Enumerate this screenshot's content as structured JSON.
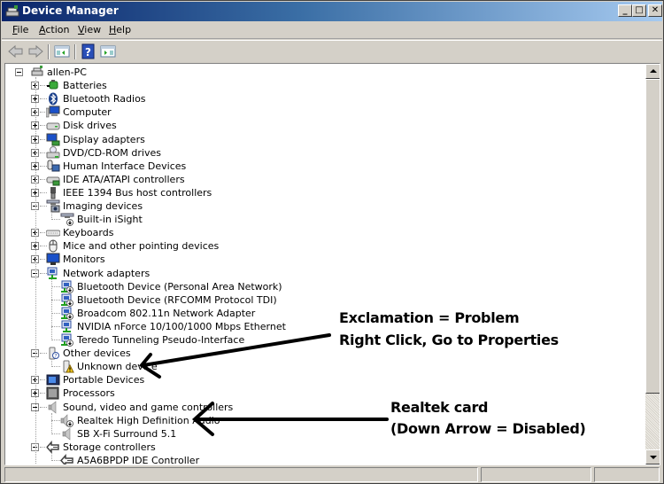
{
  "window": {
    "title": "Device Manager",
    "controls": {
      "minimize": "_",
      "maximize": "□",
      "close": "✕"
    }
  },
  "menu": [
    {
      "label": "File",
      "accel": "F"
    },
    {
      "label": "Action",
      "accel": "A"
    },
    {
      "label": "View",
      "accel": "V"
    },
    {
      "label": "Help",
      "accel": "H"
    }
  ],
  "toolbar": [
    {
      "name": "back-button",
      "icon": "arrow-left-icon",
      "enabled": false
    },
    {
      "name": "forward-button",
      "icon": "arrow-right-icon",
      "enabled": false
    },
    {
      "name": "show-hide-console-tree-button",
      "icon": "console-tree-icon"
    },
    {
      "name": "help-button",
      "icon": "help-icon",
      "glyph": "?"
    },
    {
      "name": "show-hide-action-pane-button",
      "icon": "action-pane-icon"
    }
  ],
  "tree": {
    "root": {
      "label": "allen-PC",
      "icon": "computer-network-icon",
      "expanded": true
    },
    "categories": [
      {
        "label": "Batteries",
        "icon": "battery-icon",
        "expanded": false,
        "children": []
      },
      {
        "label": "Bluetooth Radios",
        "icon": "bluetooth-icon",
        "expanded": false,
        "children": []
      },
      {
        "label": "Computer",
        "icon": "computer-icon",
        "expanded": false,
        "children": []
      },
      {
        "label": "Disk drives",
        "icon": "disk-drive-icon",
        "expanded": false,
        "children": []
      },
      {
        "label": "Display adapters",
        "icon": "display-adapter-icon",
        "expanded": false,
        "children": []
      },
      {
        "label": "DVD/CD-ROM drives",
        "icon": "dvd-drive-icon",
        "expanded": false,
        "children": []
      },
      {
        "label": "Human Interface Devices",
        "icon": "hid-icon",
        "expanded": false,
        "children": []
      },
      {
        "label": "IDE ATA/ATAPI controllers",
        "icon": "ide-controller-icon",
        "expanded": false,
        "children": []
      },
      {
        "label": "IEEE 1394 Bus host controllers",
        "icon": "firewire-icon",
        "expanded": false,
        "children": []
      },
      {
        "label": "Imaging devices",
        "icon": "camera-icon",
        "expanded": true,
        "children": [
          {
            "label": "Built-in iSight",
            "icon": "camera-disabled-icon",
            "status": "disabled"
          }
        ]
      },
      {
        "label": "Keyboards",
        "icon": "keyboard-icon",
        "expanded": false,
        "children": []
      },
      {
        "label": "Mice and other pointing devices",
        "icon": "mouse-icon",
        "expanded": false,
        "children": []
      },
      {
        "label": "Monitors",
        "icon": "monitor-icon",
        "expanded": false,
        "children": []
      },
      {
        "label": "Network adapters",
        "icon": "network-adapter-icon",
        "expanded": true,
        "children": [
          {
            "label": "Bluetooth Device (Personal Area Network)",
            "icon": "network-adapter-disabled-icon",
            "status": "disabled"
          },
          {
            "label": "Bluetooth Device (RFCOMM Protocol TDI)",
            "icon": "network-adapter-disabled-icon",
            "status": "disabled"
          },
          {
            "label": "Broadcom 802.11n Network Adapter",
            "icon": "network-adapter-disabled-icon",
            "status": "disabled"
          },
          {
            "label": "NVIDIA nForce 10/100/1000 Mbps Ethernet",
            "icon": "network-adapter-icon",
            "status": "ok"
          },
          {
            "label": "Teredo Tunneling Pseudo-Interface",
            "icon": "network-adapter-disabled-icon",
            "status": "disabled"
          }
        ]
      },
      {
        "label": "Other devices",
        "icon": "unknown-device-icon",
        "expanded": true,
        "children": [
          {
            "label": "Unknown device",
            "icon": "warning-device-icon",
            "status": "problem"
          }
        ]
      },
      {
        "label": "Portable Devices",
        "icon": "portable-device-icon",
        "expanded": false,
        "children": []
      },
      {
        "label": "Processors",
        "icon": "processor-icon",
        "expanded": false,
        "children": []
      },
      {
        "label": "Sound, video and game controllers",
        "icon": "speaker-icon",
        "expanded": true,
        "children": [
          {
            "label": "Realtek High Definition Audio",
            "icon": "speaker-disabled-icon",
            "status": "disabled"
          },
          {
            "label": "SB X-Fi Surround 5.1",
            "icon": "speaker-icon",
            "status": "ok"
          }
        ]
      },
      {
        "label": "Storage controllers",
        "icon": "storage-controller-icon",
        "expanded": true,
        "children": [
          {
            "label": "A5A6BPDP IDE Controller",
            "icon": "storage-controller-icon",
            "status": "ok"
          }
        ]
      }
    ]
  },
  "annotations": [
    {
      "lines": [
        "Exclamation = Problem",
        "Right Click, Go to Properties"
      ],
      "points_to": "Unknown device"
    },
    {
      "lines": [
        "Realtek card",
        "(Down Arrow = Disabled)"
      ],
      "points_to": "Realtek High Definition Audio"
    }
  ],
  "statusbar": {
    "panels": [
      "",
      "",
      ""
    ]
  },
  "colors": {
    "titlebar_start": "#0a246a",
    "titlebar_end": "#a6caf0",
    "chrome": "#d4d0c8",
    "tree_bg": "#ffffff"
  }
}
